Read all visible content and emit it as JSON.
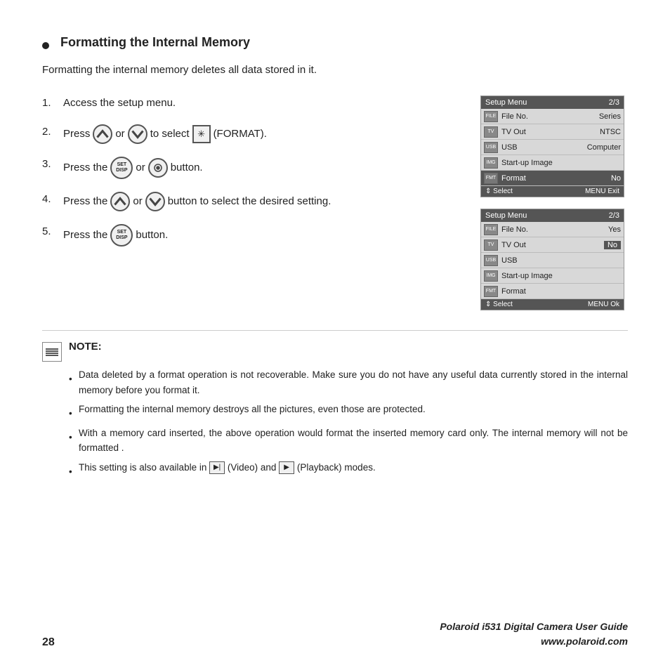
{
  "page": {
    "title": "Formatting the Internal Memory",
    "subtitle": "Formatting the internal memory deletes all data stored in it.",
    "steps": [
      {
        "num": "1.",
        "text": "Access the setup menu."
      },
      {
        "num": "2.",
        "text_before": "Press",
        "or1": "or",
        "text_after": "to select",
        "format_symbol": "※",
        "format_label": "(FORMAT)."
      },
      {
        "num": "3.",
        "text_before": "Press the",
        "or2": "or",
        "text_after": "button."
      },
      {
        "num": "4.",
        "text_before": "Press the",
        "or3": "or",
        "text_after": "button to select the desired setting."
      },
      {
        "num": "5.",
        "text_before": "Press the",
        "text_after": "button."
      }
    ],
    "menu1": {
      "header_left": "Setup Menu",
      "header_right": "2/3",
      "rows": [
        {
          "icon": "■",
          "label": "File No.",
          "value": "Series"
        },
        {
          "icon": "▣",
          "label": "TV Out",
          "value": "NTSC"
        },
        {
          "icon": "⊞",
          "label": "USB",
          "value": "Computer"
        },
        {
          "icon": "▤",
          "label": "Start-up Image",
          "value": ""
        },
        {
          "icon": "▦",
          "label": "Format",
          "value": "No",
          "highlighted": true
        }
      ],
      "footer_left": "⇕ Select",
      "footer_right": "MENU Exit"
    },
    "menu2": {
      "header_left": "Setup Menu",
      "header_right": "2/3",
      "rows": [
        {
          "icon": "■",
          "label": "File No.",
          "value": "Yes"
        },
        {
          "icon": "▣",
          "label": "TV Out",
          "value": "No",
          "value_highlight": true
        },
        {
          "icon": "⊞",
          "label": "USB",
          "value": ""
        },
        {
          "icon": "▤",
          "label": "Start-up Image",
          "value": ""
        },
        {
          "icon": "▦",
          "label": "Format",
          "value": ""
        }
      ],
      "footer_left": "⇕ Select",
      "footer_right": "MENU Ok"
    },
    "note": {
      "label": "NOTE:",
      "bullets": [
        "Data deleted by a format operation is not recoverable. Make sure you do not have any useful data currently stored in the internal memory before you format it.",
        "Formatting the internal memory destroys all the pictures, even those are protected.",
        "With a memory card inserted, the above operation would format the inserted memory card only. The internal memory will not be formatted .",
        "This setting is also available in  (Video) and  (Playback) modes."
      ]
    },
    "footer": {
      "page_number": "28",
      "brand_line1": "Polaroid i531 Digital Camera User Guide",
      "brand_line2": "www.polaroid.com"
    }
  }
}
